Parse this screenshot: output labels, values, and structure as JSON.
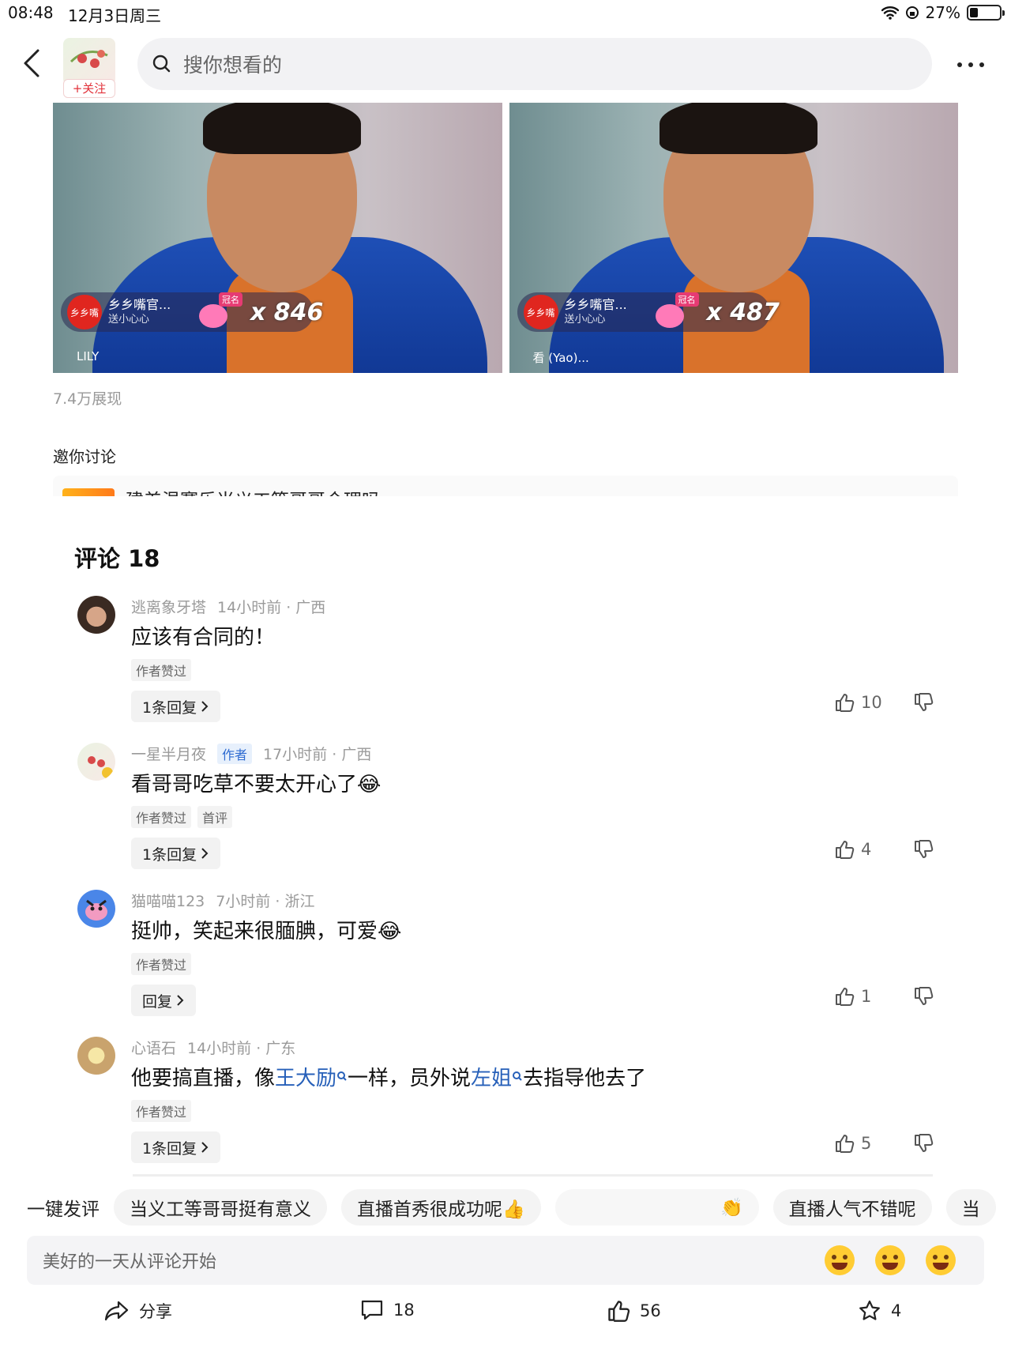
{
  "status": {
    "time": "08:48",
    "date": "12月3日周三",
    "battery": "27%",
    "battery_level": 0.27
  },
  "header": {
    "follow_label": "+关注",
    "search_placeholder": "搜你想看的"
  },
  "photos": [
    {
      "channel": "乡乡嘴官...",
      "sub": "送小心心",
      "logo": "乡乡嘴",
      "badge": "冠名",
      "count": "x 846",
      "bottom": "LILY"
    },
    {
      "channel": "乡乡嘴官...",
      "sub": "送小心心",
      "logo": "乡乡嘴",
      "badge": "冠名",
      "count": "x 487",
      "bottom": "看 (Yao)..."
    }
  ],
  "views": "7.4万展现",
  "discuss": {
    "title": "邀你讨论",
    "topic": "建差温蹇乐当义工等哥哥合理吗"
  },
  "comments_title": "评论 18",
  "comments": [
    {
      "user": "逃离象牙塔",
      "time": "14小时前 · 广西",
      "text": "应该有合同的！",
      "tags": [
        "作者赞过"
      ],
      "reply": "1条回复",
      "likes": "10"
    },
    {
      "user": "一星半月夜",
      "author_tag": "作者",
      "time": "17小时前 · 广西",
      "text": "看哥哥吃草不要太开心了😂",
      "tags": [
        "作者赞过",
        "首评"
      ],
      "reply": "1条回复",
      "likes": "4"
    },
    {
      "user": "猫喵喵123",
      "time": "7小时前 · 浙江",
      "text": "挺帅，笑起来很腼腆，可爱😂",
      "tags": [
        "作者赞过"
      ],
      "reply": "回复",
      "likes": "1"
    },
    {
      "user": "心语石",
      "time": "14小时前 · 广东",
      "text_parts": [
        "他要搞直播，像",
        "王大励",
        "一样，员外说",
        "左姐",
        "去指导他去了"
      ],
      "tags": [
        "作者赞过"
      ],
      "reply": "1条回复",
      "likes": "5"
    }
  ],
  "quick": {
    "lead": "一键发评",
    "chips": [
      "当义工等哥哥挺有意义",
      "直播首秀很成功呢👍",
      "👏",
      "直播人气不错呢",
      "当"
    ]
  },
  "input": {
    "placeholder": "美好的一天从评论开始"
  },
  "actions": {
    "share": "分享",
    "comments": "18",
    "likes": "56",
    "favorites": "4"
  }
}
